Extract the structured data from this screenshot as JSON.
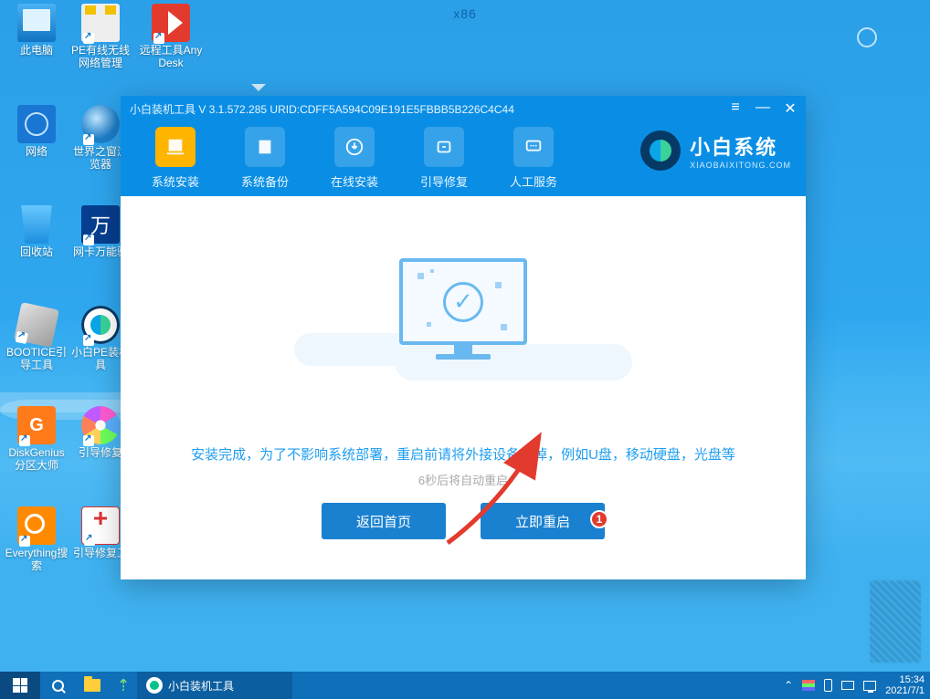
{
  "arch_label": "x86",
  "desktop_icons": [
    {
      "id": "this-pc",
      "label": "此电脑"
    },
    {
      "id": "pe-net",
      "label": "PE有线无线网络管理"
    },
    {
      "id": "anydesk",
      "label": "远程工具AnyDesk"
    },
    {
      "id": "network",
      "label": "网络"
    },
    {
      "id": "world-window",
      "label": "世界之窗浏览器"
    },
    {
      "id": "recycle",
      "label": "回收站"
    },
    {
      "id": "net-driver",
      "label": "网卡万能驱"
    },
    {
      "id": "bootice",
      "label": "BOOTICE引导工具"
    },
    {
      "id": "xb-pe",
      "label": "小白PE装机具"
    },
    {
      "id": "diskgenius",
      "label": "DiskGenius分区大师"
    },
    {
      "id": "boot-repair",
      "label": "引导修复"
    },
    {
      "id": "everything",
      "label": "Everything搜索"
    },
    {
      "id": "boot-repair-tool",
      "label": "引导修复工"
    }
  ],
  "app": {
    "title": "小白装机工具 V 3.1.572.285 URID:CDFF5A594C09E191E5FBBB5B226C4C44",
    "tabs": {
      "install": "系统安装",
      "backup": "系统备份",
      "online": "在线安装",
      "bootfix": "引导修复",
      "service": "人工服务"
    },
    "brand_cn": "小白系统",
    "brand_en": "XIAOBAIXITONG.COM",
    "msg_main": "安装完成，为了不影响系统部署，重启前请将外接设备拔掉，例如U盘，移动硬盘，光盘等",
    "msg_sub": "6秒后将自动重启",
    "btn_back": "返回首页",
    "btn_restart": "立即重启",
    "marker": "1"
  },
  "taskbar": {
    "app_label": "小白装机工具",
    "time": "15:34",
    "date": "2021/7/1"
  }
}
